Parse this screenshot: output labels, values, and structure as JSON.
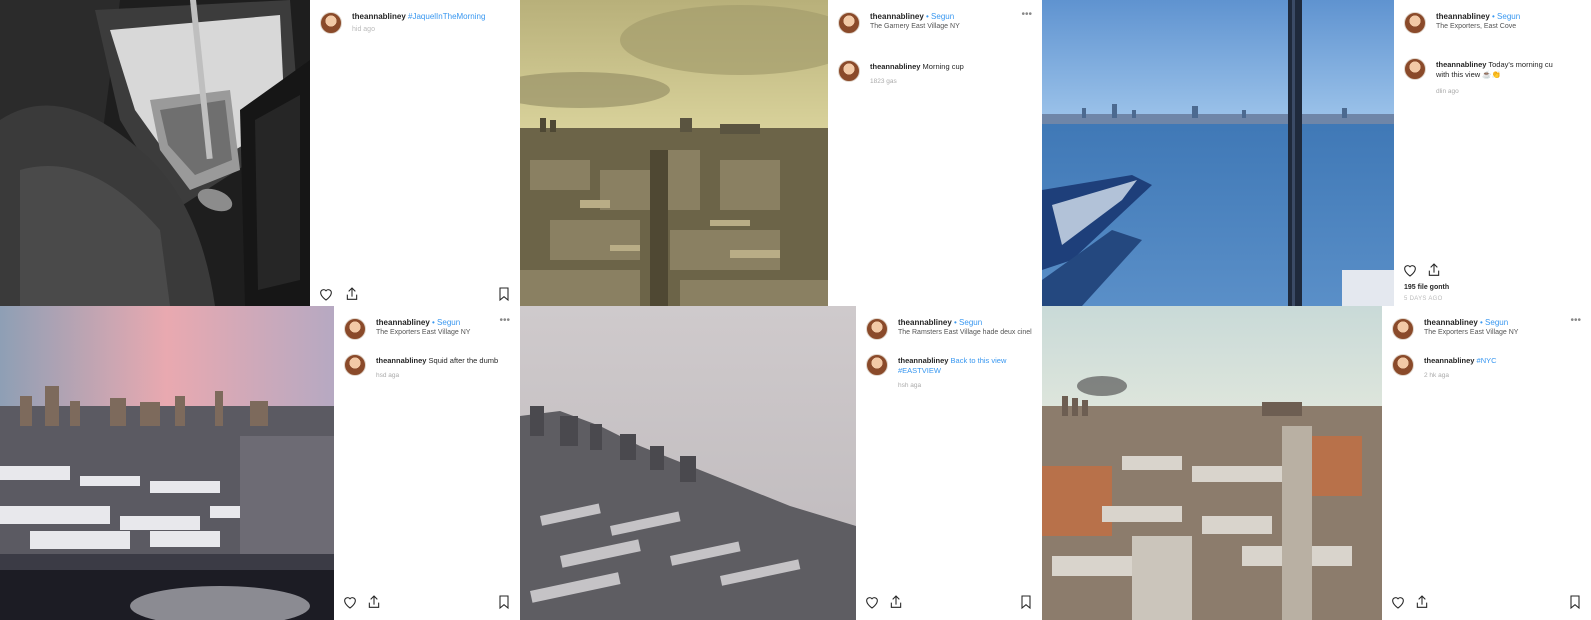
{
  "posts": [
    {
      "username": "theannabliney",
      "follow_text": "#JaquelInTheMorning",
      "location": "",
      "caption_user": "",
      "caption_text": "",
      "time": "hid ago"
    },
    {
      "username": "theannabliney",
      "follow_text": "• Segun",
      "location": "The Garnery East Village NY",
      "caption_user": "theannabliney",
      "caption_text": "Morning cup",
      "time": "1823 gas"
    },
    {
      "username": "theannabliney",
      "follow_text": "• Segun",
      "location": "The Exporters, East Cove",
      "caption_user": "theannabliney",
      "caption_text": "Today's morning cu with this view ☕👏",
      "time": "dlin ago",
      "likes": "195 file gonth",
      "date": "5 DAYS AGO"
    },
    {
      "username": "theannabliney",
      "follow_text": "• Segun",
      "location": "The Exporters East Village NY",
      "caption_user": "theannabliney",
      "caption_text": "Squid after the dumb",
      "time": "hsd aga"
    },
    {
      "username": "theannabliney",
      "follow_text": "• Segun",
      "location": "The Ramsters East Village hade deux cinel",
      "caption_user": "theannabliney",
      "caption_text": "Back to this view #EASTVIEW",
      "time": "hsh aga"
    },
    {
      "username": "theannabliney",
      "follow_text": "• Segun",
      "location": "The Exporters East Village NY",
      "caption_user": "theannabliney",
      "caption_text": "#NYC",
      "time": "2 hk aga"
    }
  ],
  "icons": {
    "like": "heart-icon",
    "share": "share-icon",
    "save": "bookmark-icon",
    "more": "more-options-icon"
  },
  "colors": {
    "link": "#3897f0",
    "text": "#262626",
    "muted": "#aaaaaa"
  }
}
